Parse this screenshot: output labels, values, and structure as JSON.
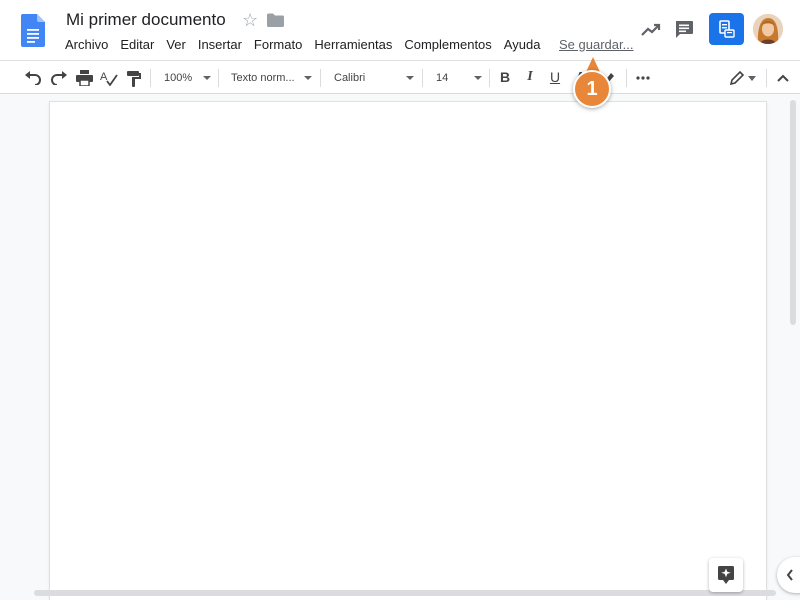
{
  "document": {
    "title": "Mi primer documento"
  },
  "menu": [
    "Archivo",
    "Editar",
    "Ver",
    "Insertar",
    "Formato",
    "Herramientas",
    "Complementos",
    "Ayuda"
  ],
  "save_status": "Se guardar...",
  "toolbar": {
    "zoom": "100%",
    "style": "Texto norm...",
    "font": "Calibri",
    "font_size": "14",
    "bold": "B",
    "italic": "I",
    "underline": "U"
  },
  "callout": {
    "number": "1"
  },
  "colors": {
    "accent": "#1a73e8",
    "callout": "#e8873a",
    "doc_blue": "#4285f4"
  }
}
